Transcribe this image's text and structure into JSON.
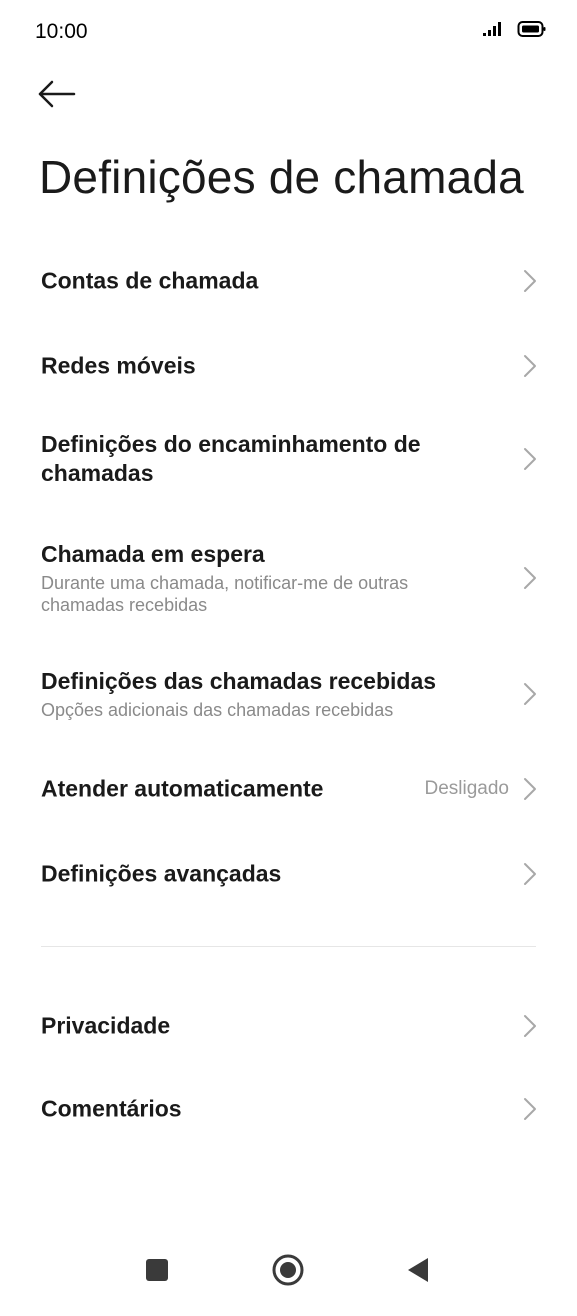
{
  "status_bar": {
    "time": "10:00",
    "icons": [
      "signal-icon",
      "battery-icon"
    ]
  },
  "header": {
    "back_icon": "arrow-left-icon",
    "title": "Definições de chamada"
  },
  "settings": {
    "items": [
      {
        "title": "Contas de chamada",
        "subtitle": "",
        "value": ""
      },
      {
        "title": "Redes móveis",
        "subtitle": "",
        "value": ""
      },
      {
        "title": "Definições do encaminhamento de chamadas",
        "subtitle": "",
        "value": ""
      },
      {
        "title": "Chamada em espera",
        "subtitle": "Durante uma chamada, notificar-me de outras chamadas recebidas",
        "value": ""
      },
      {
        "title": "Definições das chamadas recebidas",
        "subtitle": "Opções adicionais das chamadas recebidas",
        "value": ""
      },
      {
        "title": "Atender automaticamente",
        "subtitle": "",
        "value": "Desligado"
      },
      {
        "title": "Definições avançadas",
        "subtitle": "",
        "value": ""
      }
    ],
    "secondary_items": [
      {
        "title": "Privacidade"
      },
      {
        "title": "Comentários"
      }
    ]
  },
  "nav_bar": {
    "buttons": [
      "recents-square-icon",
      "home-circle-icon",
      "back-triangle-icon"
    ]
  },
  "colors": {
    "text_primary": "#1a1a1a",
    "text_secondary": "#8a8a8a",
    "chevron": "#a8a8a8",
    "divider": "#e6e6e6",
    "nav_icon": "#3a3a3a"
  }
}
